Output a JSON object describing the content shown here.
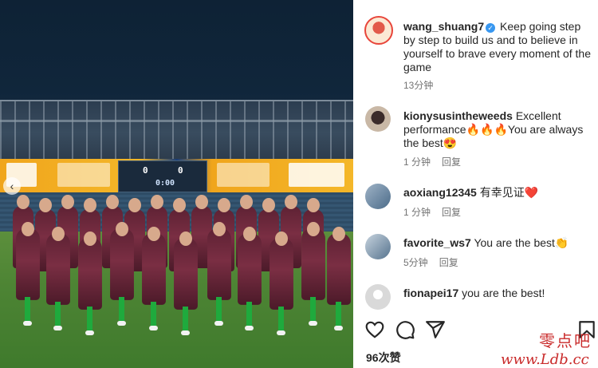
{
  "photo": {
    "gallery_prev_glyph": "‹",
    "scoreboard": {
      "home_score": "0",
      "away_score": "0",
      "clock": "0:00"
    }
  },
  "post": {
    "username": "wang_shuang7",
    "verified_glyph": "✓",
    "caption": "Keep going step by step to build us and to believe in yourself to brave every moment of the game",
    "time": "13分钟"
  },
  "comments": [
    {
      "username": "kionysusintheweeds",
      "text": "Excellent performance🔥🔥🔥You are always the best😍",
      "time": "1 分钟",
      "reply_label": "回复"
    },
    {
      "username": "aoxiang12345",
      "text": "有幸见证❤️",
      "time": "1 分钟",
      "reply_label": "回复"
    },
    {
      "username": "favorite_ws7",
      "text": "You are the best👏",
      "time": "5分钟",
      "reply_label": "回复"
    },
    {
      "username": "fionapei17",
      "text": "you are the best!",
      "time": "",
      "reply_label": ""
    }
  ],
  "actions": {
    "icons": [
      "heart-icon",
      "comment-icon",
      "share-icon",
      "bookmark-icon"
    ],
    "likes": "96次赞"
  },
  "watermark": {
    "line1": "零点吧",
    "line2": "www.Ldb.cc"
  },
  "colors": {
    "verified": "#3897f0",
    "watermark": "#c92a2a",
    "meta": "#737373"
  }
}
